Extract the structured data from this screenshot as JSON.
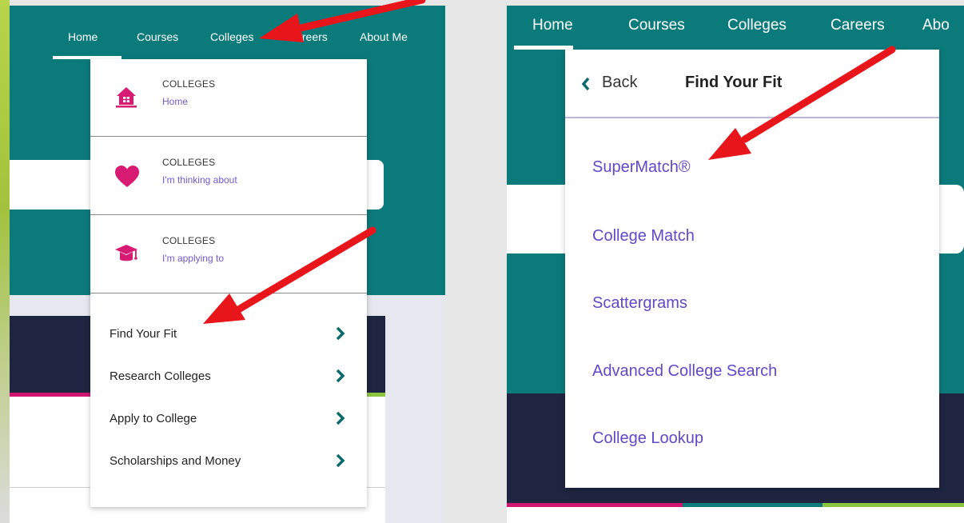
{
  "left": {
    "nav": [
      "Home",
      "Courses",
      "Colleges",
      "Careers",
      "About Me"
    ],
    "colleges_items": [
      {
        "category": "COLLEGES",
        "label": "Home",
        "icon": "house-icon"
      },
      {
        "category": "COLLEGES",
        "label": "I'm thinking about",
        "icon": "heart-icon"
      },
      {
        "category": "COLLEGES",
        "label": "I'm applying to",
        "icon": "graduation-cap-icon"
      }
    ],
    "menu": [
      "Find Your Fit",
      "Research Colleges",
      "Apply to College",
      "Scholarships and Money"
    ]
  },
  "right": {
    "nav": [
      "Home",
      "Courses",
      "Colleges",
      "Careers",
      "Abo"
    ],
    "back_label": "Back",
    "title": "Find Your Fit",
    "links": [
      "SuperMatch®",
      "College Match",
      "Scattergrams",
      "Advanced College Search",
      "College Lookup"
    ]
  },
  "colors": {
    "teal": "#0b7a7b",
    "navy": "#1f2541",
    "magenta": "#d1166f",
    "link_purple": "#5f48c9",
    "arrow_red": "#e8151b"
  }
}
